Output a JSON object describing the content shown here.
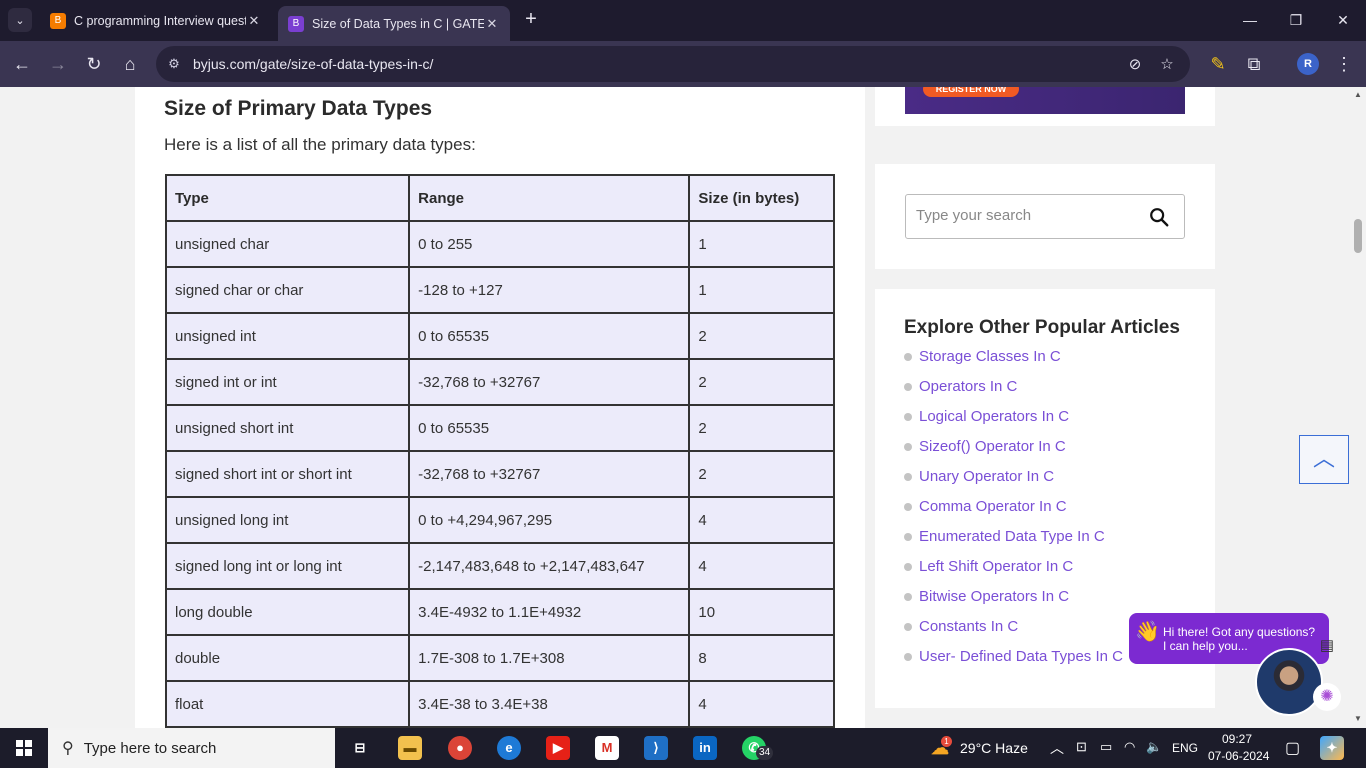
{
  "browser": {
    "tabs": [
      {
        "title": "C programming Interview questi",
        "active": false
      },
      {
        "title": "Size of Data Types in C | GATE N",
        "active": true
      }
    ],
    "url": "byjus.com/gate/size-of-data-types-in-c/",
    "profile_initial": "R"
  },
  "article": {
    "heading": "Size of Primary Data Types",
    "lead": "Here is a list of all the primary data types:",
    "table": {
      "headers": [
        "Type",
        "Range",
        "Size (in bytes)"
      ],
      "rows": [
        [
          "unsigned char",
          "0 to 255",
          "1"
        ],
        [
          "signed char or char",
          "-128 to +127",
          "1"
        ],
        [
          "unsigned int",
          "0 to 65535",
          "2"
        ],
        [
          "signed int or int",
          "-32,768 to +32767",
          "2"
        ],
        [
          "unsigned short int",
          "0 to 65535",
          "2"
        ],
        [
          "signed short int or short int",
          "-32,768 to +32767",
          "2"
        ],
        [
          "unsigned long int",
          "0 to +4,294,967,295",
          "4"
        ],
        [
          "signed long int or long int",
          "-2,147,483,648 to +2,147,483,647",
          "4"
        ],
        [
          "long double",
          "3.4E-4932 to 1.1E+4932",
          "10"
        ],
        [
          "double",
          "1.7E-308 to 1.7E+308",
          "8"
        ],
        [
          "float",
          "3.4E-38 to 3.4E+38",
          "4"
        ]
      ]
    }
  },
  "sidebar": {
    "banner_button": "REGISTER NOW",
    "search_placeholder": "Type your search",
    "explore_title": "Explore Other Popular Articles",
    "links": [
      "Storage Classes In C",
      "Operators In C",
      "Logical Operators In C",
      "Sizeof() Operator In C",
      "Unary Operator In C",
      "Comma Operator In C",
      "Enumerated Data Type In C",
      "Left Shift Operator In C",
      "Bitwise Operators In C",
      "Constants In C",
      "User- Defined Data Types In C"
    ]
  },
  "chat": {
    "line1": "Hi there! Got any questions?",
    "line2": "I can help you..."
  },
  "taskbar": {
    "search_placeholder": "Type here to search",
    "whatsapp_badge": "34",
    "weather_badge": "1",
    "weather": "29°C  Haze",
    "language": "ENG",
    "time": "09:27",
    "date": "07-06-2024"
  }
}
